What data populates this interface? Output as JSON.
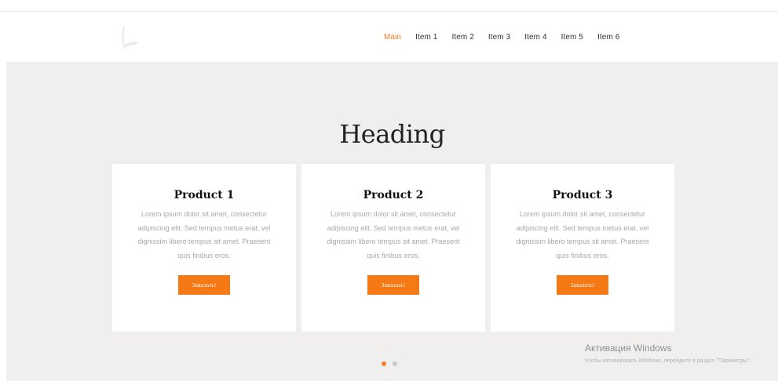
{
  "colors": {
    "accent": "#f47b2a",
    "button": "#f57a16",
    "hero_bg": "#f0efed"
  },
  "header": {
    "logo_icon": "script-logo-icon",
    "nav": [
      {
        "label": "Main",
        "active": true
      },
      {
        "label": "Item 1",
        "active": false
      },
      {
        "label": "Item 2",
        "active": false
      },
      {
        "label": "Item 3",
        "active": false
      },
      {
        "label": "Item 4",
        "active": false
      },
      {
        "label": "Item 5",
        "active": false
      },
      {
        "label": "Item 6",
        "active": false
      }
    ]
  },
  "hero": {
    "heading": "Heading",
    "products": [
      {
        "title": "Product 1",
        "text": "Lorem ipsum dolor sit amet, consectetur adipiscing elit. Sed tempus metus erat, vel dignissim libero tempus sit amet. Praesent quis finibus eros.",
        "button": "Заказать!"
      },
      {
        "title": "Product 2",
        "text": "Lorem ipsum dolor sit amet, consectetur adipiscing elit. Sed tempus metus erat, vel dignissim libero tempus sit amet. Praesent quis finibus eros.",
        "button": "Заказать!"
      },
      {
        "title": "Product 3",
        "text": "Lorem ipsum dolor sit amet, consectetur adipiscing elit. Sed tempus metus erat, vel dignissim libero tempus sit amet. Praesent quis finibus eros.",
        "button": "Заказать!"
      }
    ],
    "carousel": {
      "active_index": 0,
      "count": 2
    }
  },
  "watermark": {
    "title": "Активация Windows",
    "text": "Чтобы активировать Windows, перейдите в раздел \"Параметры\"."
  }
}
